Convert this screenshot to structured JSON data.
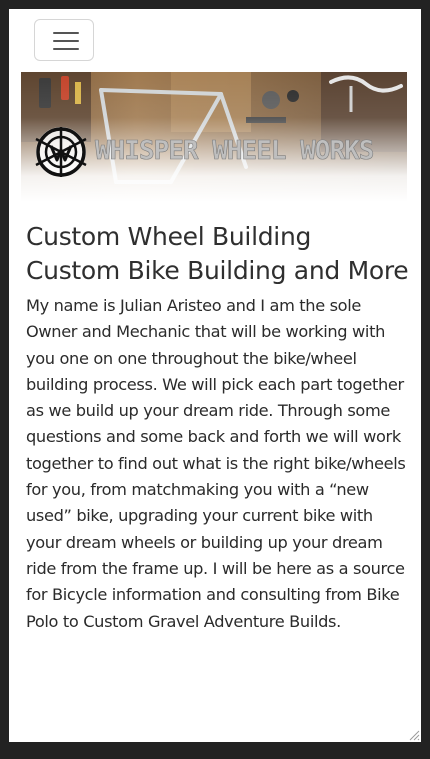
{
  "navbar": {
    "menu_icon": "hamburger-menu-icon"
  },
  "hero": {
    "brand": "WHISPER WHEEL WORKS",
    "logo_icon": "wheel-logo-icon"
  },
  "main": {
    "title": "Custom Wheel Building",
    "subtitle": "Custom Bike Building and More",
    "body": "My name is Julian Aristeo and I am the sole Owner and Mechanic that will be working with you one on one throughout the bike/wheel building process. We will pick each part together as we build up your dream ride. Through some questions and some back and forth we will work together to find out what is the right bike/wheels for you, from matchmaking you with a “new used” bike, upgrading your current bike with your dream wheels or building up your dream ride from the frame up. I will be here as a source for Bicycle information and consulting from Bike Polo to Custom Gravel Adventure Builds."
  },
  "colors": {
    "page_bg": "#222222",
    "content_bg": "#ffffff",
    "text": "#2f2f2f"
  }
}
